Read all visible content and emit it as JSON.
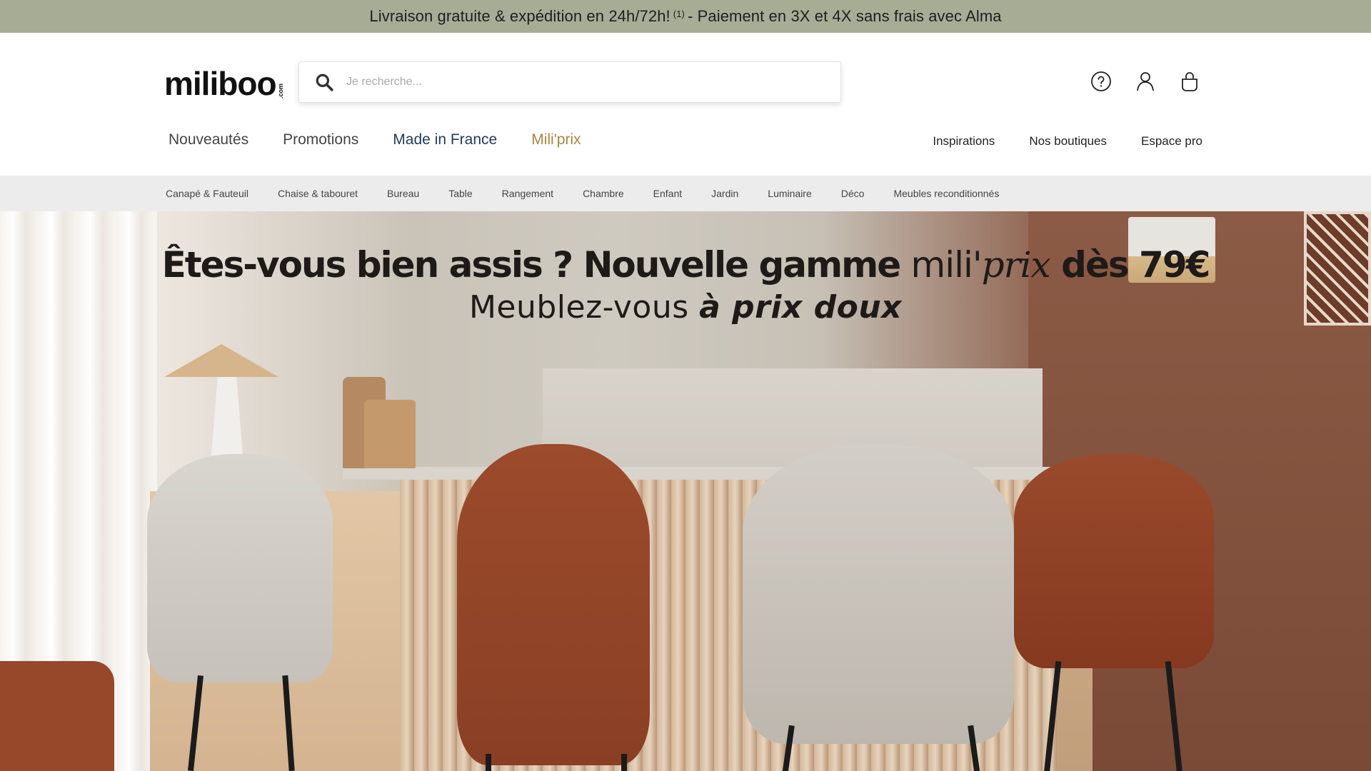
{
  "promo": {
    "text_before": "Livraison gratuite & expédition en 24h/72h!",
    "footnote": "(1)",
    "text_after": "- Paiement en 3X et 4X sans frais avec Alma"
  },
  "header": {
    "logo": {
      "name": "miliboo",
      "suffix": ".com"
    },
    "search": {
      "placeholder": "Je recherche...",
      "value": ""
    },
    "icons": [
      "help-icon",
      "account-icon",
      "cart-icon"
    ]
  },
  "main_nav": {
    "items": [
      "Nouveautés",
      "Promotions",
      "Made in France",
      "Mili'prix"
    ]
  },
  "right_nav": {
    "items": [
      "Inspirations",
      "Nos boutiques",
      "Espace pro"
    ]
  },
  "categories": [
    "Canapé & Fauteuil",
    "Chaise & tabouret",
    "Bureau",
    "Table",
    "Rangement",
    "Chambre",
    "Enfant",
    "Jardin",
    "Luminaire",
    "Déco",
    "Meubles reconditionnés"
  ],
  "hero": {
    "headline_part1": "Êtes-vous bien assis ? Nouvelle gamme ",
    "brand_mili": "mili'",
    "brand_prix": "prix",
    "headline_part2": " dès 79€",
    "subline_regular": "Meublez-vous ",
    "subline_emphasis": "à prix doux"
  },
  "colors": {
    "promo_bg": "#a7ad95",
    "made_in_france": "#1f3a5a",
    "miliprix": "#a9863e",
    "category_bar": "#ececec"
  }
}
